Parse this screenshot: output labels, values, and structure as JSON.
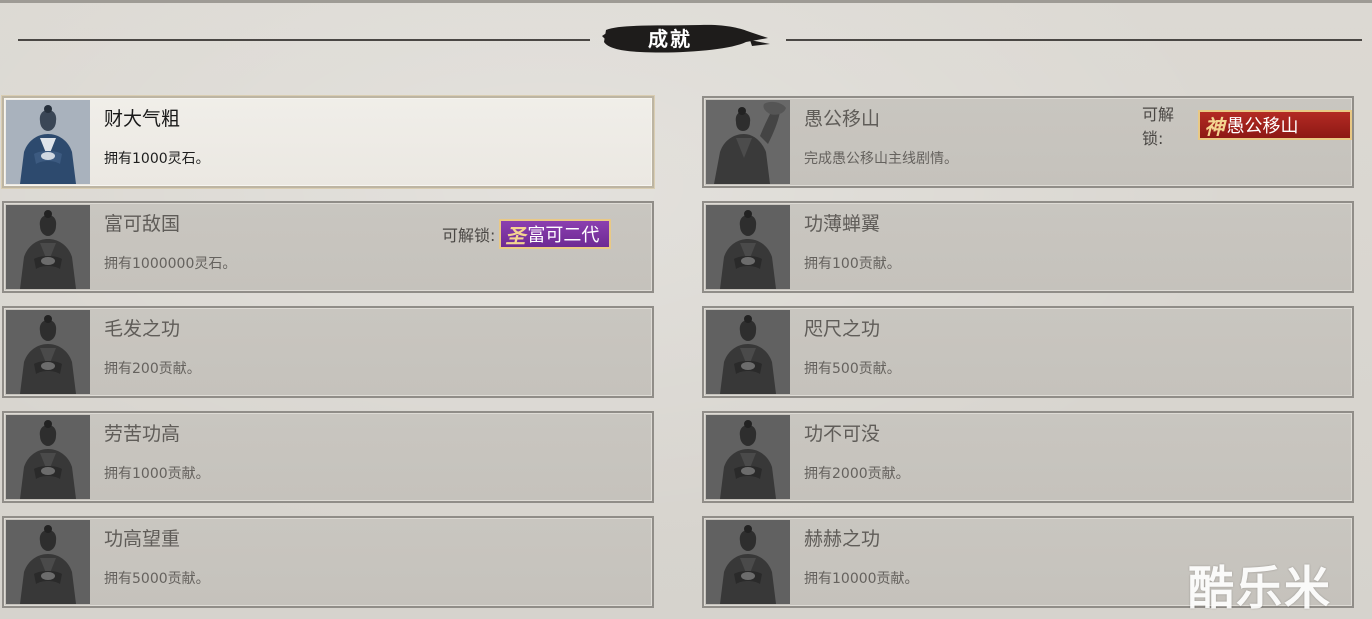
{
  "header": {
    "title": "成就"
  },
  "unlock_label": "可解锁:",
  "achievements": [
    {
      "name": "财大气粗",
      "desc": "拥有1000灵石。",
      "active": true
    },
    {
      "name": "愚公移山",
      "desc": "完成愚公移山主线剧情。",
      "unlock": {
        "glyph": "神",
        "text": "愚公移山",
        "color": "#a8231d"
      }
    },
    {
      "name": "富可敌国",
      "desc": "拥有1000000灵石。",
      "unlock": {
        "glyph": "圣",
        "text": "富可二代",
        "color": "#7d34a3"
      }
    },
    {
      "name": "功薄蝉翼",
      "desc": "拥有100贡献。"
    },
    {
      "name": "毛发之功",
      "desc": "拥有200贡献。"
    },
    {
      "name": "咫尺之功",
      "desc": "拥有500贡献。"
    },
    {
      "name": "劳苦功高",
      "desc": "拥有1000贡献。"
    },
    {
      "name": "功不可没",
      "desc": "拥有2000贡献。"
    },
    {
      "name": "功高望重",
      "desc": "拥有5000贡献。"
    },
    {
      "name": "赫赫之功",
      "desc": "拥有10000贡献。"
    }
  ],
  "watermark": "酷乐米"
}
